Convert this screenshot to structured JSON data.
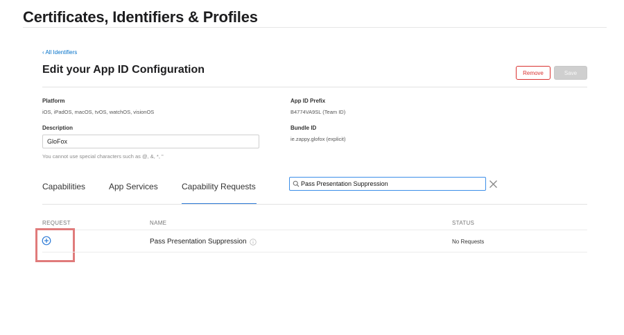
{
  "header": {
    "title": "Certificates, Identifiers & Profiles"
  },
  "nav": {
    "back_link": "‹ All Identifiers"
  },
  "section": {
    "title": "Edit your App ID Configuration",
    "remove_label": "Remove",
    "save_label": "Save"
  },
  "fields": {
    "platform_label": "Platform",
    "platform_value": "iOS, iPadOS, macOS, tvOS, watchOS, visionOS",
    "description_label": "Description",
    "description_value": "GloFox",
    "description_hint": "You cannot use special characters such as @, &, *, \"",
    "prefix_label": "App ID Prefix",
    "prefix_value": "B4774VA9SL (Team ID)",
    "bundle_label": "Bundle ID",
    "bundle_value": "ie.zappy.glofox (explicit)"
  },
  "tabs": [
    {
      "label": "Capabilities",
      "active": false
    },
    {
      "label": "App Services",
      "active": false
    },
    {
      "label": "Capability Requests",
      "active": true
    }
  ],
  "search": {
    "value": "Pass Presentation Suppression",
    "icon": "search-icon"
  },
  "table": {
    "columns": [
      "REQUEST",
      "NAME",
      "STATUS"
    ],
    "rows": [
      {
        "name": "Pass Presentation Suppression",
        "status": "No Requests",
        "icon": "add-circle-icon"
      }
    ]
  },
  "colors": {
    "accent": "#0070c9",
    "danger": "#d9312f",
    "highlight": "#e07b7b"
  }
}
